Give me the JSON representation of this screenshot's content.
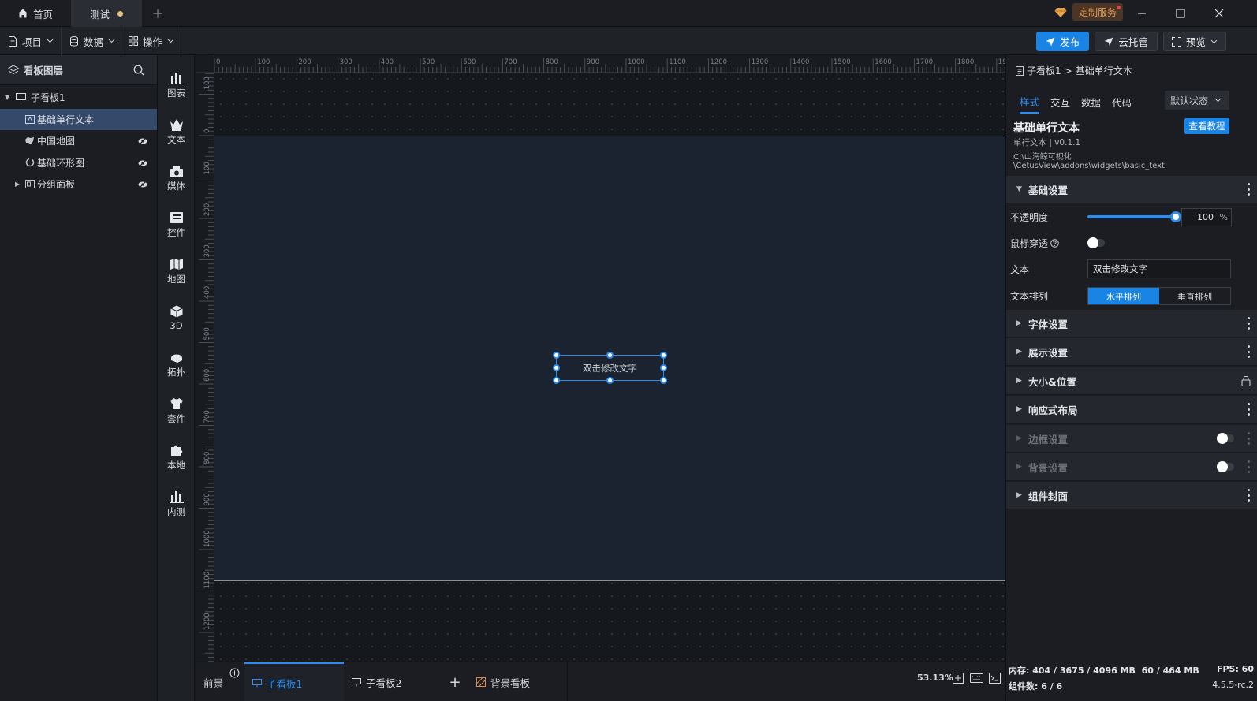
{
  "titlebar": {
    "tabs": [
      {
        "label": "首页",
        "icon": "home-icon"
      },
      {
        "label": "测试",
        "unsaved": true
      }
    ],
    "add_tab": "+",
    "custom_service": "定制服务"
  },
  "menubar": {
    "menus": [
      {
        "label": "项目",
        "icon": "file-icon"
      },
      {
        "label": "数据",
        "icon": "database-icon"
      },
      {
        "label": "操作",
        "icon": "grid-icon"
      }
    ],
    "publish": "发布",
    "cloud_host": "云托管",
    "preview": "预览"
  },
  "layers": {
    "title": "看板图层",
    "items": [
      {
        "label": "子看板1",
        "level": 0,
        "icon": "board-icon",
        "expanded": true
      },
      {
        "label": "基础单行文本",
        "level": 1,
        "icon": "text-widget-icon",
        "selected": true,
        "hidden": false
      },
      {
        "label": "中国地图",
        "level": 1,
        "icon": "map-icon",
        "hidden": true
      },
      {
        "label": "基础环形图",
        "level": 1,
        "icon": "ring-chart-icon",
        "hidden": true
      },
      {
        "label": "分组面板",
        "level": 1,
        "icon": "group-panel-icon",
        "hidden": true,
        "collapsed": true
      }
    ]
  },
  "widgets": [
    {
      "label": "图表",
      "icon": "bar-chart-icon"
    },
    {
      "label": "文本",
      "icon": "text-crown-icon"
    },
    {
      "label": "媒体",
      "icon": "media-icon"
    },
    {
      "label": "控件",
      "icon": "control-icon"
    },
    {
      "label": "地图",
      "icon": "map-icon"
    },
    {
      "label": "3D",
      "icon": "cube-icon"
    },
    {
      "label": "拓扑",
      "icon": "topology-icon"
    },
    {
      "label": "套件",
      "icon": "shirt-icon"
    },
    {
      "label": "本地",
      "icon": "puzzle-icon"
    },
    {
      "label": "内测",
      "icon": "bar-chart-icon"
    }
  ],
  "canvas": {
    "ruler_top": [
      "0",
      "100",
      "200",
      "300",
      "400",
      "500",
      "600",
      "700",
      "800",
      "900",
      "1000",
      "1100",
      "1200",
      "1300",
      "1400",
      "1500",
      "1600",
      "1700",
      "1800",
      "1900"
    ],
    "ruler_left": [
      "-100",
      "0",
      "100",
      "200",
      "300",
      "400",
      "500",
      "600",
      "700",
      "800",
      "900",
      "1000",
      "1100",
      "1200"
    ],
    "widget_text": "双击修改文字"
  },
  "bottombar": {
    "foreground": "前景",
    "tabs": [
      {
        "label": "子看板1",
        "active": true
      },
      {
        "label": "子看板2",
        "active": false
      }
    ],
    "add": "+",
    "background_board": "背景看板",
    "zoom": "53.13%"
  },
  "props": {
    "breadcrumb": {
      "parent": "子看板1",
      "sep": ">",
      "current": "基础单行文本"
    },
    "tabs": [
      "样式",
      "交互",
      "数据",
      "代码"
    ],
    "state_select": "默认状态",
    "component": {
      "name": "基础单行文本",
      "subtitle": "单行文本 | v0.1.1",
      "path_line1": "C:\\山海鲸可视化",
      "path_line2": "\\CetusView\\addons\\widgets\\basic_text",
      "tutorial": "查看教程"
    },
    "basic": {
      "title": "基础设置",
      "opacity_label": "不透明度",
      "opacity_value": "100",
      "opacity_unit": "%",
      "opacity_fraction": 1.0,
      "mouse_through_label": "鼠标穿透",
      "mouse_through_on": false,
      "text_label": "文本",
      "text_value": "双击修改文字",
      "arrange_label": "文本排列",
      "arrange_options": [
        "水平排列",
        "垂直排列"
      ],
      "arrange_selected": "水平排列"
    },
    "sections": [
      {
        "label": "字体设置",
        "control": "menu",
        "disabled": false
      },
      {
        "label": "展示设置",
        "control": "menu",
        "disabled": false
      },
      {
        "label": "大小&位置",
        "control": "lock",
        "disabled": false
      },
      {
        "label": "响应式布局",
        "control": "menu",
        "disabled": false
      },
      {
        "label": "边框设置",
        "control": "toggle",
        "disabled": true
      },
      {
        "label": "背景设置",
        "control": "toggle",
        "disabled": true
      },
      {
        "label": "组件封面",
        "control": "menu",
        "disabled": false
      }
    ]
  },
  "status": {
    "memory": "内存: 404 / 3675 / 4096 MB  60 / 464 MB",
    "fps": "FPS: 60",
    "components": "组件数: 6 / 6",
    "version": "4.5.5-rc.2"
  },
  "colors": {
    "accent": "#2d8cf0",
    "primary_button": "#1a84e5",
    "board": "#1b2330"
  }
}
